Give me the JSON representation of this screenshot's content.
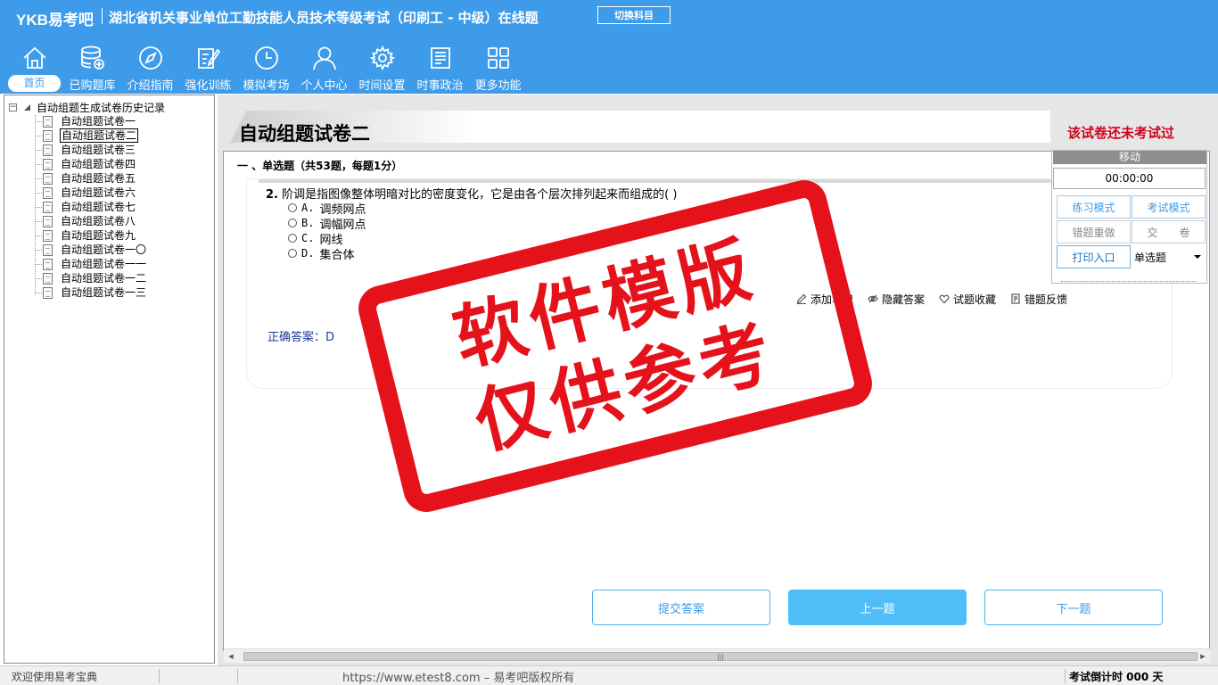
{
  "header": {
    "logo": "YKB易考吧",
    "title": "湖北省机关事业单位工勤技能人员技术等级考试（印刷工 - 中级）在线题",
    "switch_subject": "切换科目",
    "bg_color": "#3d9be9"
  },
  "nav": {
    "items": [
      {
        "label": "首页",
        "icon": "home-icon"
      },
      {
        "label": "已购题库",
        "icon": "database-add-icon"
      },
      {
        "label": "介绍指南",
        "icon": "compass-icon"
      },
      {
        "label": "强化训练",
        "icon": "edit-icon"
      },
      {
        "label": "模拟考场",
        "icon": "clock-icon"
      },
      {
        "label": "个人中心",
        "icon": "user-icon"
      },
      {
        "label": "时间设置",
        "icon": "gear-icon"
      },
      {
        "label": "时事政治",
        "icon": "news-icon"
      },
      {
        "label": "更多功能",
        "icon": "grid-icon"
      }
    ]
  },
  "tree": {
    "root": "自动组题生成试卷历史记录",
    "items": [
      "自动组题试卷一",
      "自动组题试卷二",
      "自动组题试卷三",
      "自动组题试卷四",
      "自动组题试卷五",
      "自动组题试卷六",
      "自动组题试卷七",
      "自动组题试卷八",
      "自动组题试卷九",
      "自动组题试卷一〇",
      "自动组题试卷一一",
      "自动组题试卷一二",
      "自动组题试卷一三"
    ],
    "selected_index": 1
  },
  "main": {
    "paper_title": "自动组题试卷二",
    "exam_status": "该试卷还未考试过",
    "section_title": "一 、单选题（共53题，每题1分）",
    "question": {
      "number": "2.",
      "text": "阶调是指图像整体明暗对比的密度变化，它是由各个层次排列起来而组成的(  )",
      "options": [
        {
          "letter": "A.",
          "text": "调频网点"
        },
        {
          "letter": "B.",
          "text": "调幅网点"
        },
        {
          "letter": "C.",
          "text": "网线"
        },
        {
          "letter": "D.",
          "text": "集合体"
        }
      ]
    },
    "actions": {
      "add_note": "添加笔记",
      "hide_answer": "隐藏答案",
      "favorite": "试题收藏",
      "feedback": "错题反馈"
    },
    "answer": "正确答案：D",
    "buttons": {
      "submit": "提交答案",
      "prev": "上一题",
      "next": "下一题"
    }
  },
  "control_panel": {
    "move": "移动",
    "timer": "00:00:00",
    "practice_mode": "练习模式",
    "exam_mode": "考试模式",
    "redo_wrong": "错题重做",
    "hand_in": "交　　卷",
    "print_entry": "打印入口",
    "question_type": "单选题"
  },
  "watermark": {
    "line1": "软件模版",
    "line2": "仅供参考",
    "color": "#e5121b"
  },
  "statusbar": {
    "welcome": "欢迎使用易考宝典",
    "copyright": "https://www.etest8.com – 易考吧版权所有",
    "countdown": "考试倒计时 000 天"
  }
}
